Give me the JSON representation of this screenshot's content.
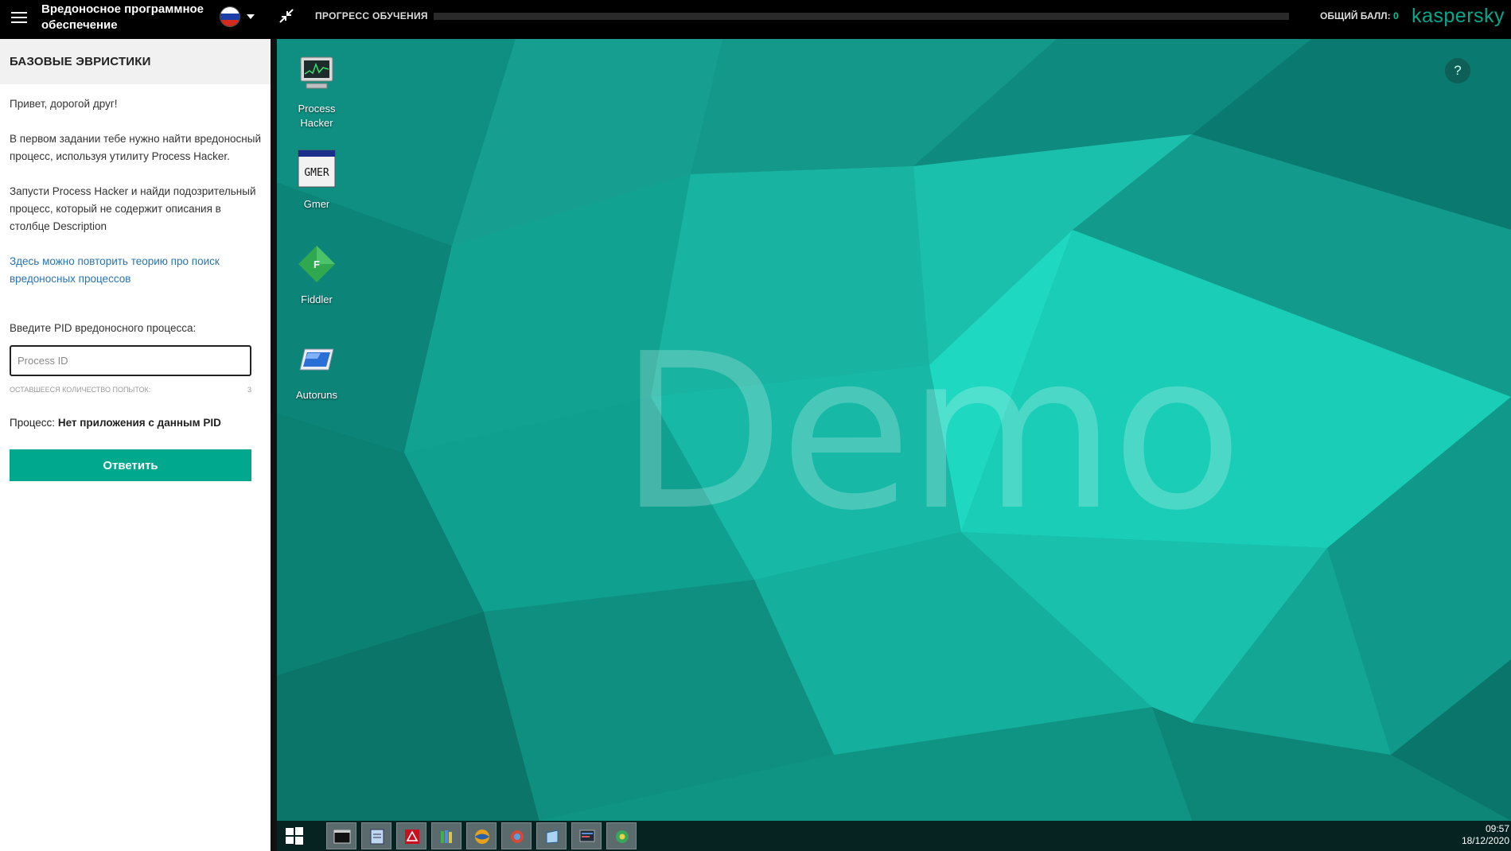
{
  "topbar": {
    "title": "Вредоносное программное обеспечение",
    "progress_label": "ПРОГРЕСС ОБУЧЕНИЯ",
    "progress_fraction": 0.0,
    "score_label": "ОБЩИЙ БАЛЛ:",
    "score_value": "0",
    "brand": "kaspersky"
  },
  "panel": {
    "header": "БАЗОВЫЕ ЭВРИСТИКИ",
    "greeting": "Привет, дорогой друг!",
    "task_text": "В первом задании тебе нужно найти вредоносный процесс, используя утилиту Process Hacker.",
    "instruction_text": "Запусти Process Hacker и найди подозрительный процесс, который не содержит описания в столбце Description",
    "theory_link": "Здесь можно повторить теорию про поиск вредоносных процессов",
    "pid_label": "Введите PID вредоносного процесса:",
    "pid_placeholder": "Process ID",
    "attempts_label": "ОСТАВШЕЕСЯ КОЛИЧЕСТВО ПОПЫТОК:",
    "attempts_value": "3",
    "process_label": "Процесс:",
    "process_value": "Нет приложения с данным PID",
    "answer_button": "Ответить"
  },
  "desktop": {
    "watermark": "Demo",
    "help": "?",
    "icons": [
      {
        "name": "process-hacker",
        "label": "Process Hacker"
      },
      {
        "name": "gmer",
        "label": "Gmer"
      },
      {
        "name": "fiddler",
        "label": "Fiddler"
      },
      {
        "name": "autoruns",
        "label": "Autoruns"
      }
    ],
    "gmer_icon_text": "GMER",
    "fiddler_icon_text": "F"
  },
  "taskbar": {
    "time": "09:57",
    "date": "18/12/2020"
  },
  "colors": {
    "accent": "#00a88e",
    "desktop_bg": "#11a391",
    "link": "#2a73b3",
    "taskbar": "#062221"
  }
}
